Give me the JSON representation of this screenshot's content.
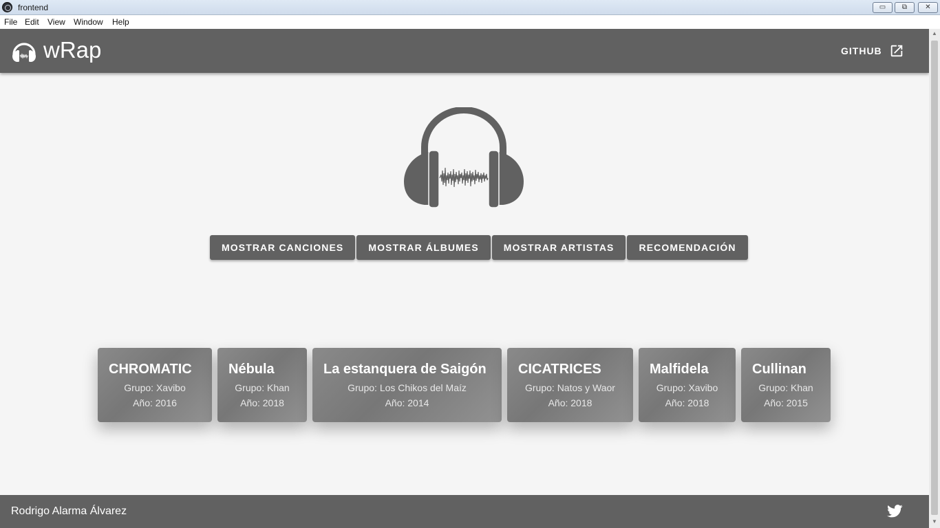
{
  "window": {
    "title": "frontend",
    "buttons": {
      "minimize": "▭",
      "maximize": "⧉",
      "close": "✕"
    }
  },
  "menu": [
    "File",
    "Edit",
    "View",
    "Window",
    "Help"
  ],
  "appbar": {
    "title": "wRap",
    "github_label": "GITHUB",
    "logo_icon": "headphones-icon",
    "github_icon": "open-in-new-icon",
    "color": "#616161"
  },
  "buttons": [
    "MOSTRAR CANCIONES",
    "MOSTRAR ÁLBUMES",
    "MOSTRAR ARTISTAS",
    "RECOMENDACIÓN"
  ],
  "cards": [
    {
      "title": "CHROMATIC",
      "group": "Grupo: Xavibo",
      "year": "Año: 2016"
    },
    {
      "title": "Nébula",
      "group": "Grupo: Khan",
      "year": "Año: 2018"
    },
    {
      "title": "La estanquera de Saigón",
      "group": "Grupo: Los Chikos del Maíz",
      "year": "Año: 2014"
    },
    {
      "title": "CICATRICES",
      "group": "Grupo: Natos y Waor",
      "year": "Año: 2018"
    },
    {
      "title": "Malfidela",
      "group": "Grupo: Xavibo",
      "year": "Año: 2018"
    },
    {
      "title": "Cullinan",
      "group": "Grupo: Khan",
      "year": "Año: 2015"
    }
  ],
  "footer": {
    "name": "Rodrigo Alarma Álvarez",
    "social_icon": "twitter-icon"
  }
}
